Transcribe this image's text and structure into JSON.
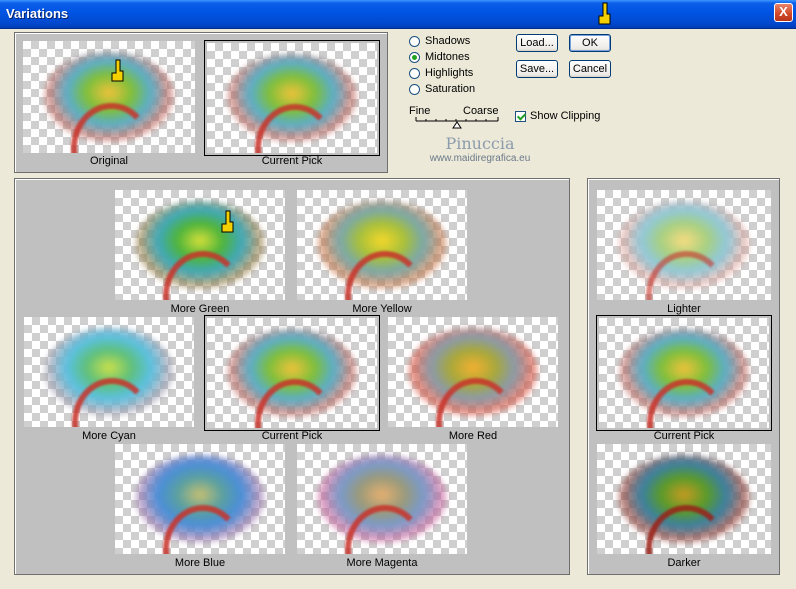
{
  "window": {
    "title": "Variations",
    "close_symbol": "X"
  },
  "preview": {
    "original_label": "Original",
    "current_pick_label": "Current Pick"
  },
  "tone": {
    "options": [
      {
        "label": "Shadows",
        "checked": false
      },
      {
        "label": "Midtones",
        "checked": true
      },
      {
        "label": "Highlights",
        "checked": false
      },
      {
        "label": "Saturation",
        "checked": false
      }
    ],
    "fine_label": "Fine",
    "coarse_label": "Coarse",
    "show_clipping_label": "Show Clipping",
    "show_clipping_checked": true
  },
  "buttons": {
    "load": "Load...",
    "ok": "OK",
    "save": "Save...",
    "cancel": "Cancel"
  },
  "watermark": {
    "name": "Pinuccia",
    "site": "www.maidiregrafica.eu"
  },
  "color_variations": {
    "more_green": "More Green",
    "more_yellow": "More Yellow",
    "more_cyan": "More Cyan",
    "current_pick": "Current Pick",
    "more_red": "More Red",
    "more_blue": "More Blue",
    "more_magenta": "More Magenta"
  },
  "brightness_variations": {
    "lighter": "Lighter",
    "current_pick": "Current Pick",
    "darker": "Darker"
  },
  "colors": {
    "titlebar": "#0054e3",
    "panel": "#c0c0c0",
    "dialog": "#ece9d8",
    "pointer": "#f5d000"
  }
}
